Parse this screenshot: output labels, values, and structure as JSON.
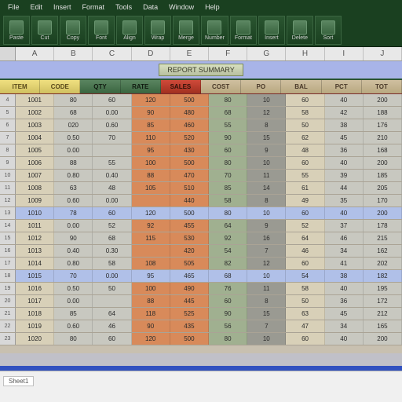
{
  "menu": [
    "File",
    "Edit",
    "Insert",
    "Format",
    "Tools",
    "Data",
    "Window",
    "Help"
  ],
  "ribbon": [
    {
      "label": "Paste"
    },
    {
      "label": "Cut"
    },
    {
      "label": "Copy"
    },
    {
      "label": "Font"
    },
    {
      "label": "Align"
    },
    {
      "label": "Wrap"
    },
    {
      "label": "Merge"
    },
    {
      "label": "Number"
    },
    {
      "label": "Format"
    },
    {
      "label": "Insert"
    },
    {
      "label": "Delete"
    },
    {
      "label": "Sort"
    }
  ],
  "columns": [
    "A",
    "B",
    "C",
    "D",
    "E",
    "F",
    "G",
    "H",
    "I",
    "J"
  ],
  "banner_tab": "REPORT SUMMARY",
  "subheaders": [
    {
      "t": "ITEM RANGE",
      "c": "sh-yel"
    },
    {
      "t": "CODE",
      "c": "sh-yel"
    },
    {
      "t": "QTY",
      "c": "sh-grn"
    },
    {
      "t": "RATE",
      "c": "sh-grn"
    },
    {
      "t": "SALES",
      "c": "sh-red"
    },
    {
      "t": "COST",
      "c": "sh-tan"
    },
    {
      "t": "PO",
      "c": "sh-tan"
    },
    {
      "t": "BAL",
      "c": "sh-tan"
    },
    {
      "t": "PCT",
      "c": "sh-tan"
    },
    {
      "t": "TOT",
      "c": "sh-tan"
    }
  ],
  "col_classes": [
    "c-a",
    "c-b",
    "c-b",
    "c-or",
    "c-or",
    "c-gr",
    "c-dk",
    "c-a",
    "c-b",
    "c-b"
  ],
  "rows": [
    [
      "1001",
      "80",
      "60",
      "120",
      "500",
      "80",
      "10",
      "60",
      "40",
      "200"
    ],
    [
      "1002",
      "68",
      "0.00",
      "90",
      "480",
      "68",
      "12",
      "58",
      "42",
      "188"
    ],
    [
      "1003",
      "020",
      "0.60",
      "85",
      "460",
      "55",
      "8",
      "50",
      "38",
      "176"
    ],
    [
      "1004",
      "0.50",
      "70",
      "110",
      "520",
      "90",
      "15",
      "62",
      "45",
      "210"
    ],
    [
      "1005",
      "0.00",
      "",
      "95",
      "430",
      "60",
      "9",
      "48",
      "36",
      "168"
    ],
    [
      "1006",
      "88",
      "55",
      "100",
      "500",
      "80",
      "10",
      "60",
      "40",
      "200"
    ],
    [
      "1007",
      "0.80",
      "0.40",
      "88",
      "470",
      "70",
      "11",
      "55",
      "39",
      "185"
    ],
    [
      "1008",
      "63",
      "48",
      "105",
      "510",
      "85",
      "14",
      "61",
      "44",
      "205"
    ],
    [
      "1009",
      "0.60",
      "0.00",
      "",
      "440",
      "58",
      "8",
      "49",
      "35",
      "170"
    ],
    [
      "1010",
      "78",
      "60",
      "120",
      "500",
      "80",
      "10",
      "60",
      "40",
      "200"
    ],
    [
      "1011",
      "0.00",
      "52",
      "92",
      "455",
      "64",
      "9",
      "52",
      "37",
      "178"
    ],
    [
      "1012",
      "90",
      "68",
      "115",
      "530",
      "92",
      "16",
      "64",
      "46",
      "215"
    ],
    [
      "1013",
      "0.40",
      "0.30",
      "",
      "420",
      "54",
      "7",
      "46",
      "34",
      "162"
    ],
    [
      "1014",
      "0.80",
      "58",
      "108",
      "505",
      "82",
      "12",
      "60",
      "41",
      "202"
    ],
    [
      "1015",
      "70",
      "0.00",
      "95",
      "465",
      "68",
      "10",
      "54",
      "38",
      "182"
    ],
    [
      "1016",
      "0.50",
      "50",
      "100",
      "490",
      "76",
      "11",
      "58",
      "40",
      "195"
    ],
    [
      "1017",
      "0.00",
      "",
      "88",
      "445",
      "60",
      "8",
      "50",
      "36",
      "172"
    ],
    [
      "1018",
      "85",
      "64",
      "118",
      "525",
      "90",
      "15",
      "63",
      "45",
      "212"
    ],
    [
      "1019",
      "0.60",
      "46",
      "90",
      "435",
      "56",
      "7",
      "47",
      "34",
      "165"
    ],
    [
      "1020",
      "80",
      "60",
      "120",
      "500",
      "80",
      "10",
      "60",
      "40",
      "200"
    ]
  ],
  "hi_rows": [
    9,
    14
  ],
  "footer_tag": "Sheet1"
}
